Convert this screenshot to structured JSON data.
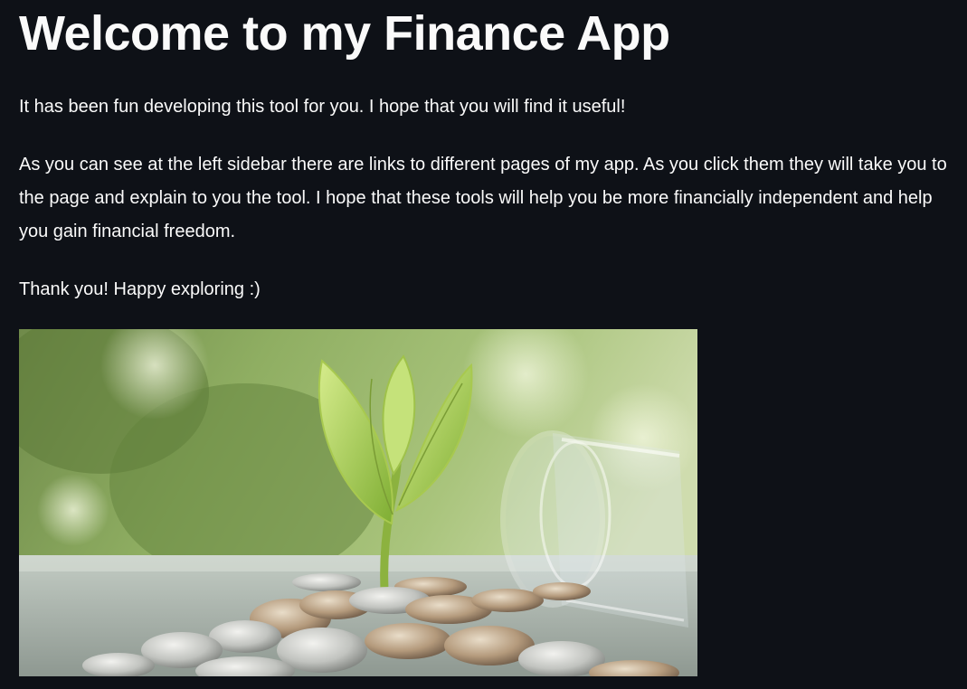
{
  "page": {
    "title": "Welcome to my Finance App",
    "paragraphs": [
      "It has been fun developing this tool for you. I hope that you will find it useful!",
      "As you can see at the left sidebar there are links to different pages of my app. As you click them they will take you to the page and explain to you the tool. I hope that these tools will help you be more financially independent and help you gain financial freedom.",
      "Thank you! Happy exploring :)"
    ]
  },
  "colors": {
    "background": "#0e1117",
    "text": "#fafafa"
  },
  "hero_image": {
    "subject": "plant-sprouting-from-coins-and-glass-jar"
  }
}
